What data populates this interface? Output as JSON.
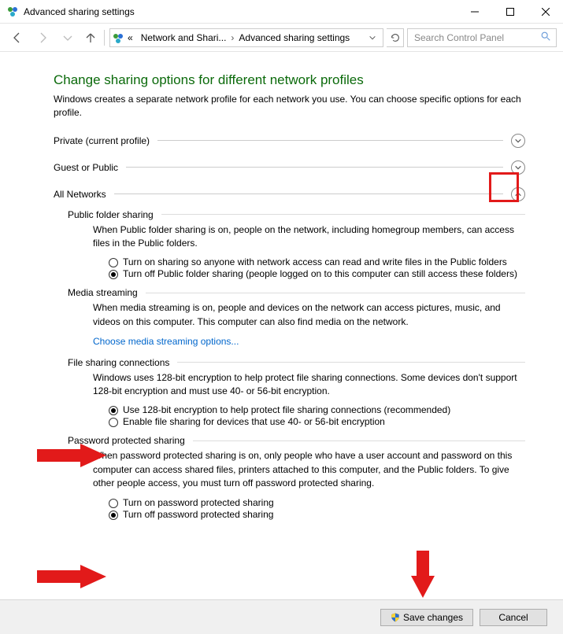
{
  "window": {
    "title": "Advanced sharing settings"
  },
  "nav": {
    "breadcrumb_root": "«",
    "crumb1": "Network and Shari...",
    "crumb2": "Advanced sharing settings",
    "search_placeholder": "Search Control Panel"
  },
  "page": {
    "heading": "Change sharing options for different network profiles",
    "subtitle": "Windows creates a separate network profile for each network you use. You can choose specific options for each profile."
  },
  "profiles": {
    "private": "Private (current profile)",
    "guest": "Guest or Public",
    "all": "All Networks"
  },
  "pfs": {
    "head": "Public folder sharing",
    "desc": "When Public folder sharing is on, people on the network, including homegroup members, can access files in the Public folders.",
    "opt_on": "Turn on sharing so anyone with network access can read and write files in the Public folders",
    "opt_off": "Turn off Public folder sharing (people logged on to this computer can still access these folders)"
  },
  "media": {
    "head": "Media streaming",
    "desc": "When media streaming is on, people and devices on the network can access pictures, music, and videos on this computer. This computer can also find media on the network.",
    "link": "Choose media streaming options..."
  },
  "fsc": {
    "head": "File sharing connections",
    "desc": "Windows uses 128-bit encryption to help protect file sharing connections. Some devices don't support 128-bit encryption and must use 40- or 56-bit encryption.",
    "opt_128": "Use 128-bit encryption to help protect file sharing connections (recommended)",
    "opt_40": "Enable file sharing for devices that use 40- or 56-bit encryption"
  },
  "pps": {
    "head": "Password protected sharing",
    "desc": "When password protected sharing is on, only people who have a user account and password on this computer can access shared files, printers attached to this computer, and the Public folders. To give other people access, you must turn off password protected sharing.",
    "opt_on": "Turn on password protected sharing",
    "opt_off": "Turn off password protected sharing"
  },
  "footer": {
    "save": "Save changes",
    "cancel": "Cancel"
  }
}
